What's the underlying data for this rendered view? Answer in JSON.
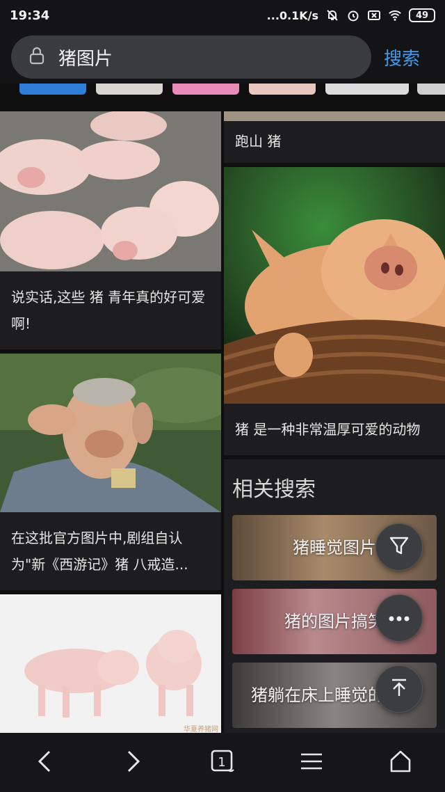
{
  "status": {
    "time": "19:34",
    "net_speed": "...0.1K/s",
    "battery": "49"
  },
  "search": {
    "query": "猪图片",
    "button": "搜索"
  },
  "results": {
    "left": [
      {
        "caption": "说实话,这些 猪 青年真的好可爱啊!"
      },
      {
        "caption": "在这批官方图片中,剧组自认为\"新《西游记》猪 八戒造..."
      },
      {
        "caption": "",
        "watermark": "华夏养猪网 PIGOL.CN 养猪门户网"
      }
    ],
    "right": [
      {
        "caption": "跑山 猪"
      },
      {
        "caption": "猪 是一种非常温厚可爱的动物"
      }
    ]
  },
  "related": {
    "title": "相关搜索",
    "items": [
      "猪睡觉图片",
      "猪的图片搞笑",
      "猪躺在床上睡觉的图片"
    ]
  },
  "colors": {
    "accent": "#3d9bf0",
    "background": "#0f0f10",
    "card": "#1d1d1f"
  },
  "icons": [
    "lock-icon",
    "filter-icon",
    "more-icon",
    "back-to-top-icon",
    "back-icon",
    "forward-icon",
    "tabs-icon",
    "menu-icon",
    "home-icon"
  ]
}
